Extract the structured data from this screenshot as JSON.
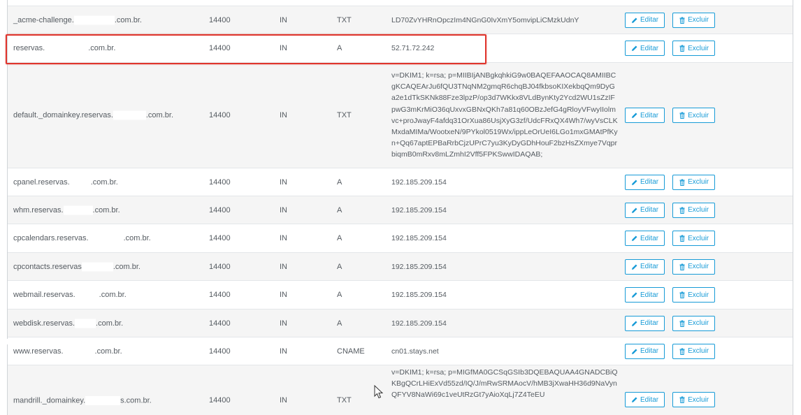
{
  "actions": {
    "edit_label": "Editar",
    "delete_label": "Excluir"
  },
  "rows": [
    {
      "name_prefix": "",
      "name_suffix": "",
      "ttl": "",
      "class": "",
      "type": "",
      "record": "",
      "height": 0
    },
    {
      "name_prefix": "_acme-challenge.",
      "name_suffix": ".com.br.",
      "ttl": "14400",
      "class": "IN",
      "type": "TXT",
      "record": "LD70ZvYHRnOpczIm4NGnG0IvXmY5omvipLiCMzkUdnY"
    },
    {
      "name_prefix": "reservas.",
      "name_suffix": ".com.br.",
      "ttl": "14400",
      "class": "IN",
      "type": "A",
      "record": "52.71.72.242"
    },
    {
      "name_prefix": "default._domainkey.reservas.",
      "name_suffix": ".com.br.",
      "ttl": "14400",
      "class": "IN",
      "type": "TXT",
      "record": "v=DKIM1; k=rsa; p=MIIBIjANBgkqhkiG9w0BAQEFAAOCAQ8AMIIBCgKCAQEArJu6fQU3TNqNM2gmqR6chqBJ04fkbsoKIXekbqQm9DyGa2e1dTkSKNk88Fze3lpzP/op3d7WKkx8VLdBynKty2Ycd2WU1sZzIFpwG3mKrMiO36qUxvxGBNxQKh7a81q60OBzJefG4gRloyVFwyIIolmvc+proJwayF4afdq31OrXua86UsjXyG3zf/UdcFRxQX4Wh7/wyVsCLKMxdaMIMa/WootxeN/9PYkol0519Wx/ippLeOrUeI6LGo1mxGMAtPfKyn+Qq67aptEPBaRrbCjzUPrC7yu3KyDyGDhHouF2bzHsZXmye7VqprbiqmB0mRxv8mLZmhI2Vff5FPKSwwIDAQAB;"
    },
    {
      "name_prefix": "cpanel.reservas.",
      "name_suffix": ".com.br.",
      "ttl": "14400",
      "class": "IN",
      "type": "A",
      "record": "192.185.209.154"
    },
    {
      "name_prefix": "whm.reservas.",
      "name_suffix": ".com.br.",
      "ttl": "14400",
      "class": "IN",
      "type": "A",
      "record": "192.185.209.154"
    },
    {
      "name_prefix": "cpcalendars.reservas.",
      "name_suffix": ".com.br.",
      "ttl": "14400",
      "class": "IN",
      "type": "A",
      "record": "192.185.209.154"
    },
    {
      "name_prefix": "cpcontacts.reservas",
      "name_suffix": ".com.br.",
      "ttl": "14400",
      "class": "IN",
      "type": "A",
      "record": "192.185.209.154"
    },
    {
      "name_prefix": "webmail.reservas.",
      "name_suffix": ".com.br.",
      "ttl": "14400",
      "class": "IN",
      "type": "A",
      "record": "192.185.209.154"
    },
    {
      "name_prefix": "webdisk.reservas.",
      "name_suffix": ".com.br.",
      "ttl": "14400",
      "class": "IN",
      "type": "A",
      "record": "192.185.209.154"
    },
    {
      "name_prefix": "www.reservas.",
      "name_suffix": ".com.br.",
      "ttl": "14400",
      "class": "IN",
      "type": "CNAME",
      "record": "cn01.stays.net"
    },
    {
      "name_prefix": "mandrill._domainkey.",
      "name_suffix": "s.com.br.",
      "ttl": "14400",
      "class": "IN",
      "type": "TXT",
      "record": "v=DKIM1; k=rsa; p=MIGfMA0GCSqGSIb3DQEBAQUAA4GNADCBiQKBgQCrLHiExVd55zd/IQ/J/mRwSRMAocV/hMB3jXwaHH36d9NaVynQFYV8NaWi69c1veUtRzGt7yAioXqLj7Z4TeEU"
    }
  ],
  "colors": {
    "accent": "#179bd7",
    "highlight": "#e0352d",
    "row_alt": "#f5f5f5"
  }
}
